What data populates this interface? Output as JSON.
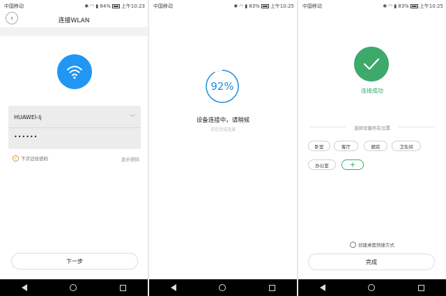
{
  "status": {
    "carrier": "中国移动",
    "battery": [
      "84%",
      "83%",
      "83%"
    ],
    "time": [
      "上午10:23",
      "上午10:25",
      "上午10:25"
    ]
  },
  "screen1": {
    "title": "连接WLAN",
    "ssid": "HUAWEI-lj",
    "password_mask": "••••••",
    "remember_label": "下次记住密码",
    "show_password": "显示密码",
    "next_button": "下一步"
  },
  "screen2": {
    "progress_percent": 92,
    "progress_label": "92%",
    "status_text": "设备连接中，请稍候",
    "sub_text": "正在完成连接"
  },
  "screen3": {
    "success_text": "连接成功",
    "location_title": "选择设备所在位置",
    "rooms": [
      "卧室",
      "客厅",
      "厨房",
      "卫生间",
      "办公室"
    ],
    "add_symbol": "+",
    "shortcut_label": "创建桌面快捷方式",
    "done_button": "完成"
  },
  "colors": {
    "wifi_blue": "#2296f3",
    "progress_blue": "#1d8fd9",
    "success_green": "#3daa6c",
    "check_orange": "#d9931c"
  }
}
